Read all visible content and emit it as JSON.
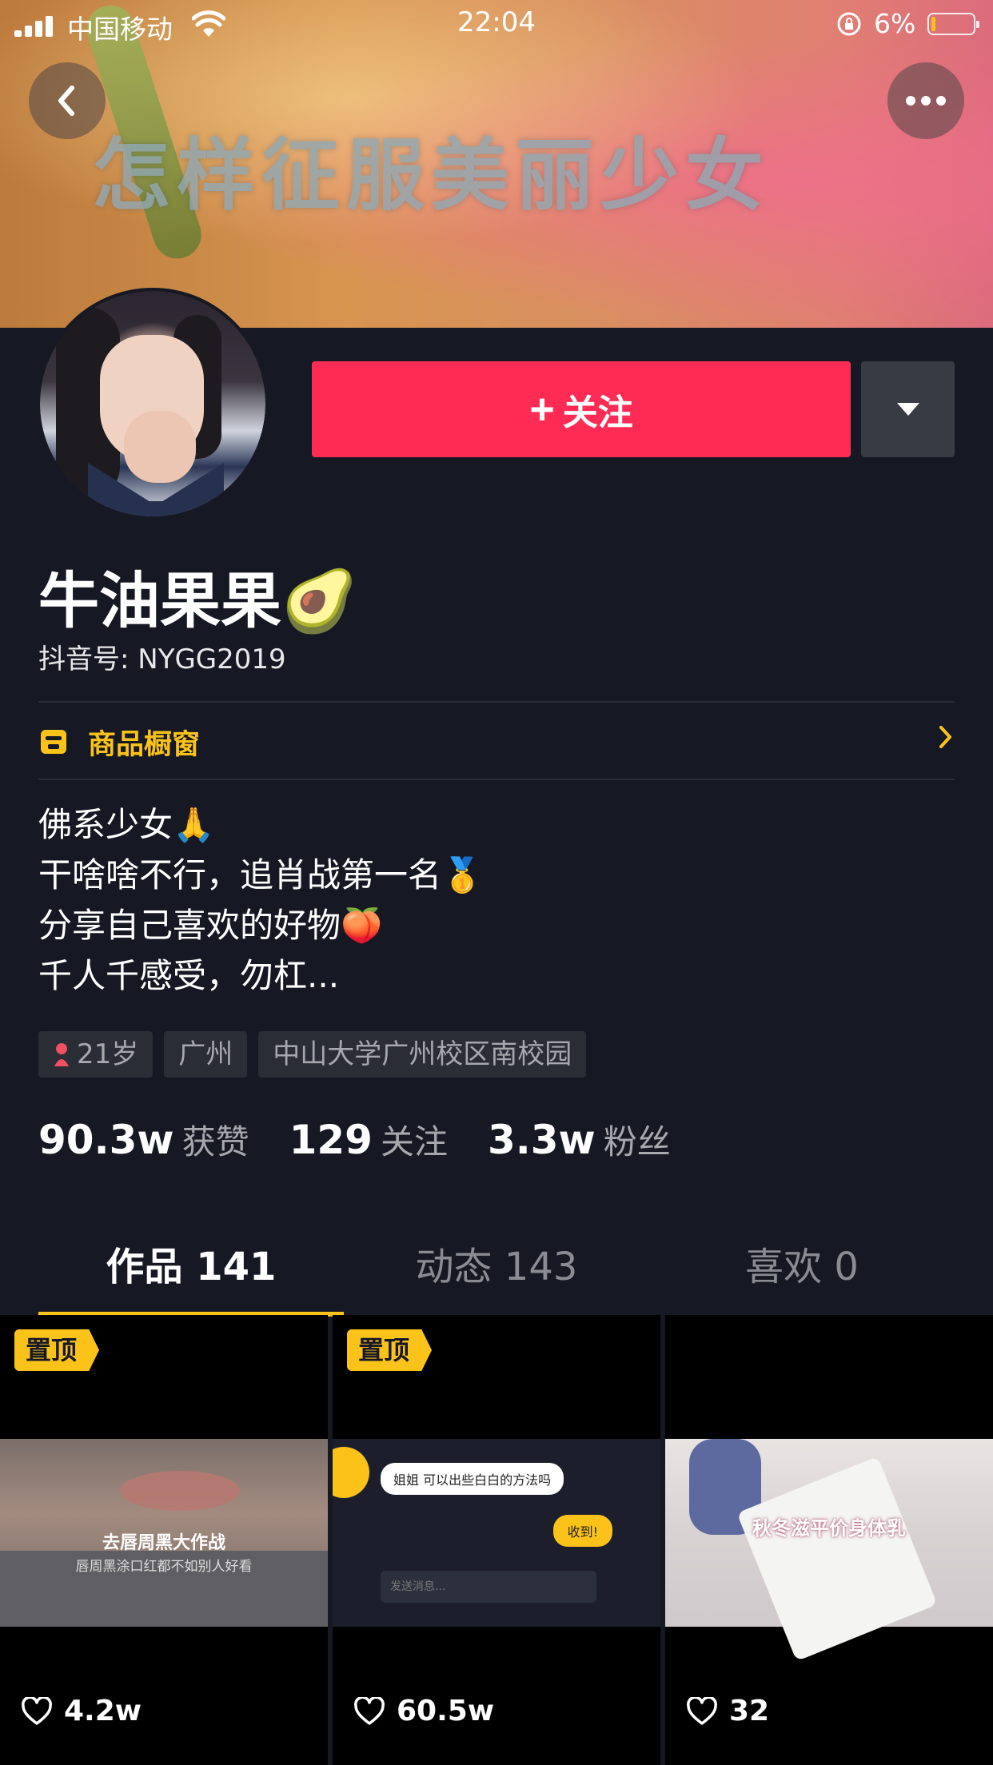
{
  "status_bar": {
    "carrier": "中国移动",
    "time": "22:04",
    "battery_pct": "6%"
  },
  "cover": {
    "caption": "怎样征服美丽少女"
  },
  "profile": {
    "follow_label": "关注",
    "nickname": "牛油果果🥑",
    "douyin_id": "抖音号: NYGG2019",
    "shop_label": "商品橱窗",
    "bio": [
      "佛系少女🙏",
      "干啥啥不行，追肖战第一名🥇",
      "分享自己喜欢的好物🍑",
      "千人千感受，勿杠..."
    ],
    "tags": [
      "21岁",
      "广州",
      "中山大学广州校区南校园"
    ],
    "stats": [
      {
        "num": "90.3w",
        "label": "获赞"
      },
      {
        "num": "129",
        "label": "关注"
      },
      {
        "num": "3.3w",
        "label": "粉丝"
      }
    ]
  },
  "tabs": [
    "作品 141",
    "动态 143",
    "喜欢 0"
  ],
  "videos": [
    {
      "pinned": "置顶",
      "likes": "4.2w",
      "title": "去唇周黑大作战",
      "subtitle": "唇周黑涂口红都不如别人好看"
    },
    {
      "pinned": "置顶",
      "likes": "60.5w",
      "chat_msg": "姐姐 可以出些白白的方法吗",
      "reply": "收到!",
      "input_hint": "发送消息..."
    },
    {
      "likes": "32",
      "title": "秋冬滋平价身体乳"
    }
  ],
  "colors": {
    "accent_red": "#fe2c55",
    "accent_yellow": "#fbc31a",
    "bg": "#161823"
  }
}
